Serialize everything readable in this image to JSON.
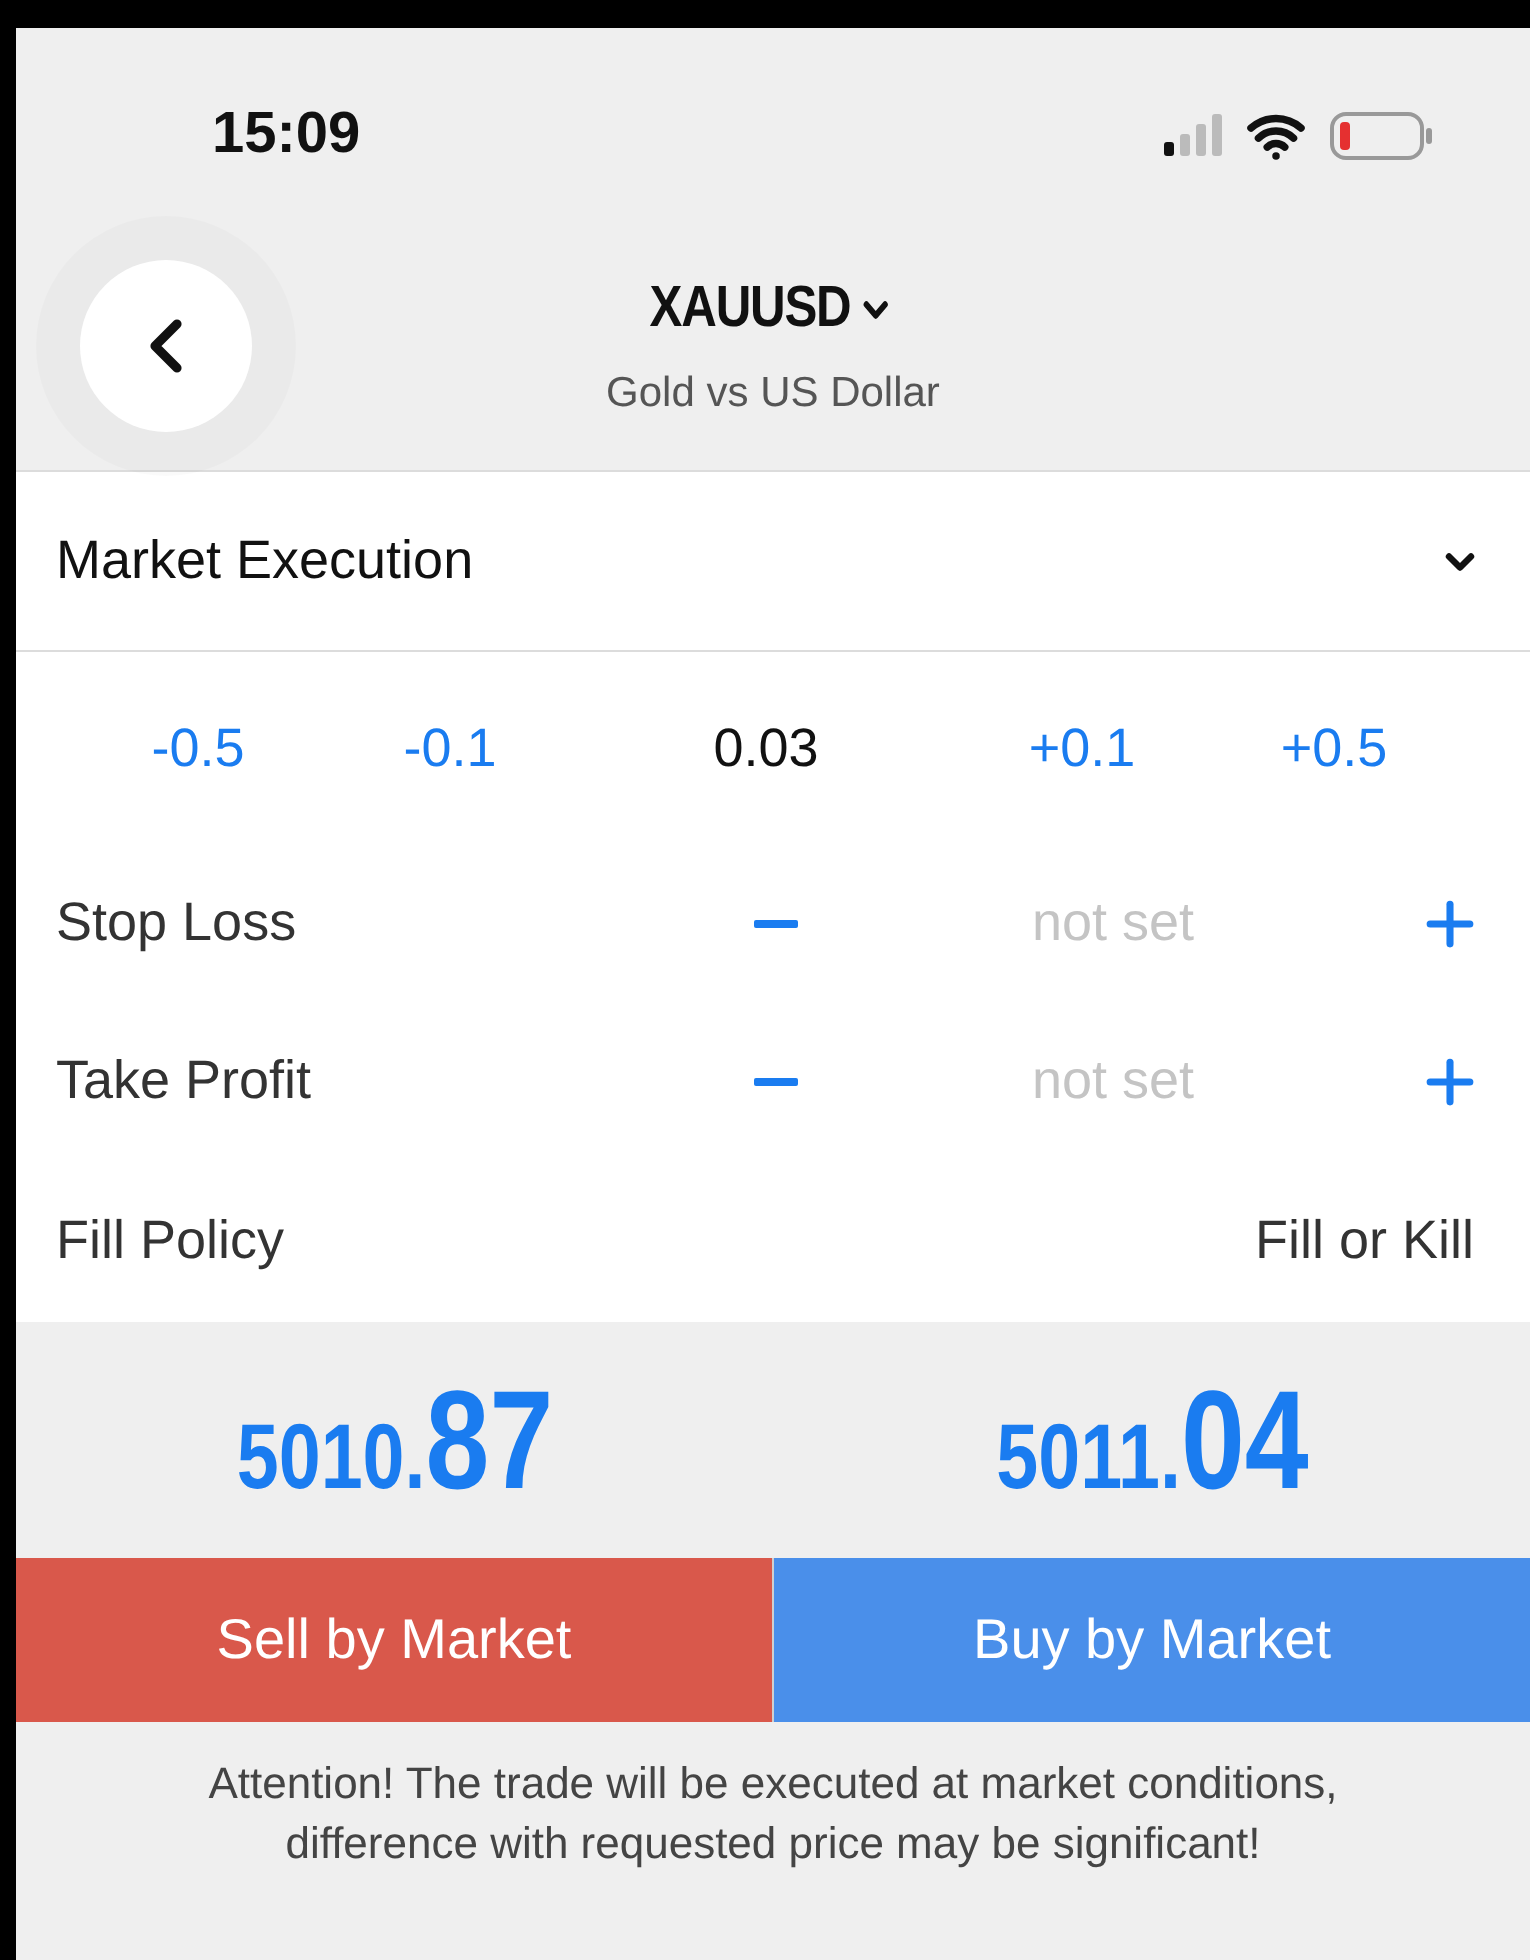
{
  "status_bar": {
    "time": "15:09"
  },
  "header": {
    "symbol": "XAUUSD",
    "description": "Gold vs US Dollar"
  },
  "execution": {
    "value": "Market Execution"
  },
  "volume": [
    {
      "kind": "step",
      "label": "-0.5"
    },
    {
      "kind": "step",
      "label": "-0.1"
    },
    {
      "kind": "value",
      "label": "0.03"
    },
    {
      "kind": "step",
      "label": "+0.1"
    },
    {
      "kind": "step",
      "label": "+0.5"
    }
  ],
  "levels": [
    {
      "label": "Stop Loss",
      "value": "not set"
    },
    {
      "label": "Take Profit",
      "value": "not set"
    }
  ],
  "fill_policy": {
    "label": "Fill Policy",
    "value": "Fill or Kill"
  },
  "prices": [
    {
      "main": "5010.",
      "pips": "87"
    },
    {
      "main": "5011.",
      "pips": "04"
    }
  ],
  "buttons": [
    {
      "kind": "sell",
      "label": "Sell by Market"
    },
    {
      "kind": "buy",
      "label": "Buy by Market"
    }
  ],
  "notice": "Attention! The trade will be executed at market conditions, difference with requested price may be significant!"
}
